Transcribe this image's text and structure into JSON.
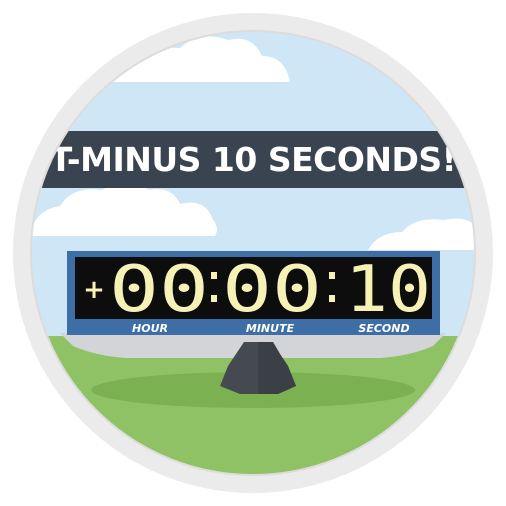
{
  "banner": {
    "text": "T-MINUS 10 SECONDS!"
  },
  "countdown": {
    "sign": "+",
    "hours": "00",
    "minutes": "00",
    "seconds": "10",
    "labels": {
      "hour": "HOUR",
      "minute": "MINUTE",
      "second": "SECOND"
    }
  },
  "colors": {
    "frame": "#ebebeb",
    "sky": "#cfe6f6",
    "cloud": "#ffffff",
    "banner": "#3a4350",
    "board_frame": "#3d6ea6",
    "display": "#0d0d0d",
    "digit": "#f6f1b4",
    "ground": "#8fc264",
    "platform": "#d2d4d8",
    "stand": "#454a50"
  }
}
